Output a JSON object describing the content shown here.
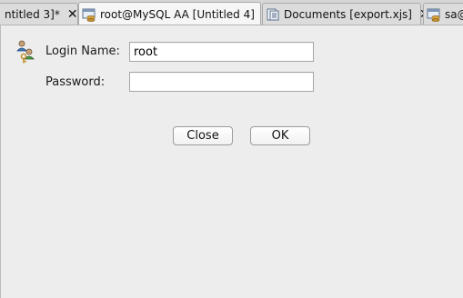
{
  "tabs": [
    {
      "label": "ntitled 3]*",
      "close": "✕",
      "icon": "none"
    },
    {
      "label": "root@MySQL AA [Untitled 4]",
      "close": "✕",
      "icon": "database-connection-icon",
      "active": true
    },
    {
      "label": "Documents [export.xjs]",
      "close": "✕",
      "icon": "document-icon"
    },
    {
      "label": "sa@",
      "icon": "database-connection-icon"
    }
  ],
  "login": {
    "name_label": "Login Name:",
    "name_value": "root",
    "password_label": "Password:",
    "password_value": ""
  },
  "buttons": {
    "close_label": "Close",
    "ok_label": "OK"
  },
  "colors": {
    "background": "#ececec",
    "tabbar": "#d6d6d6",
    "active_tab": "#f6f6f6"
  }
}
